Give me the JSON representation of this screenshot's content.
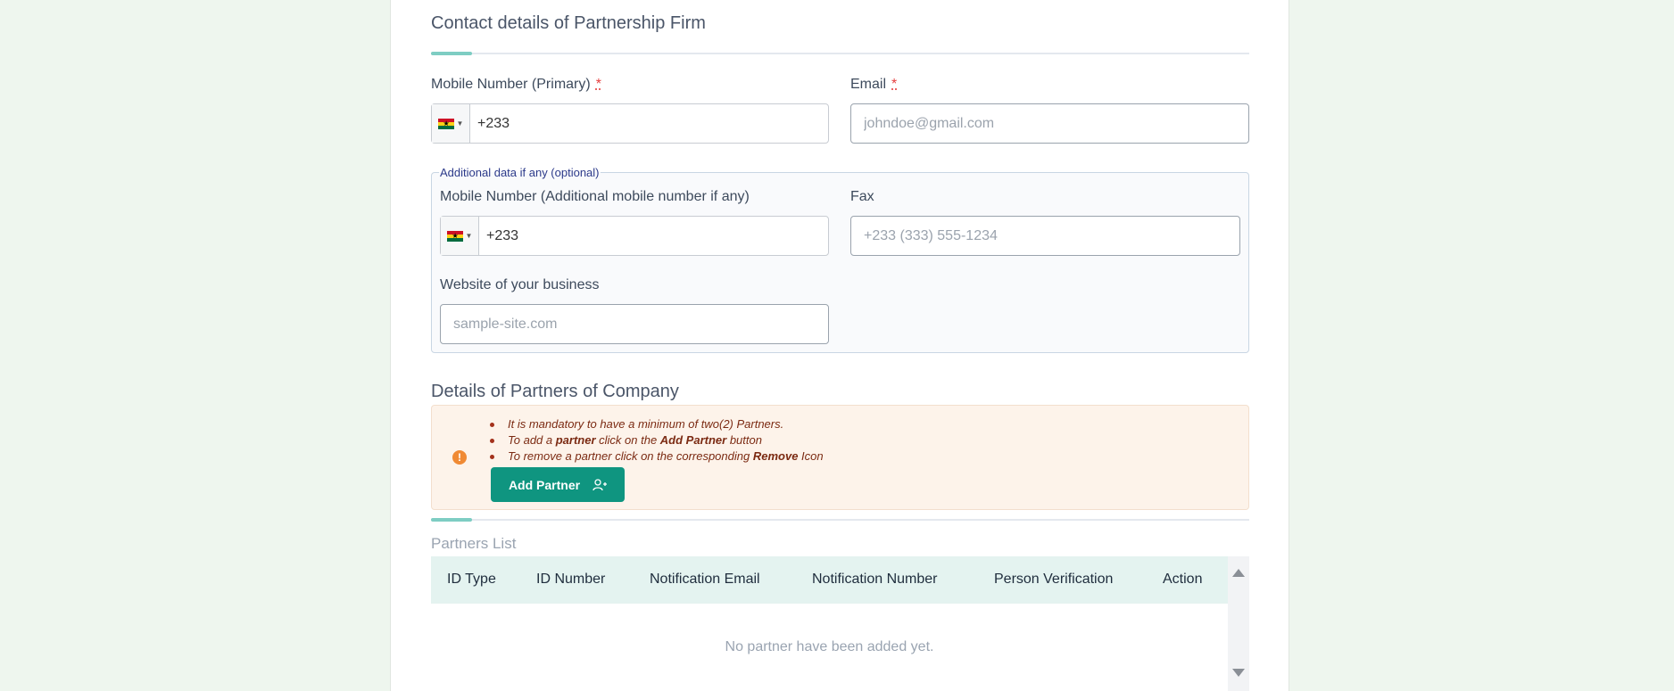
{
  "contact": {
    "title": "Contact details of Partnership Firm",
    "mobile_label": "Mobile Number (Primary)",
    "required_mark": "*",
    "mobile_value": "+233",
    "email_label": "Email",
    "email_placeholder": "johndoe@gmail.com"
  },
  "additional": {
    "legend": "Additional data if any (optional)",
    "mobile_label": "Mobile Number (Additional mobile number if any)",
    "mobile_value": "+233",
    "fax_label": "Fax",
    "fax_placeholder": "+233 (333) 555-1234",
    "website_label": "Website of your business",
    "website_placeholder": "sample-site.com"
  },
  "partners": {
    "title": "Details of Partners of Company",
    "notes": {
      "line1": "It is mandatory to have a minimum of two(2) Partners.",
      "line2_pre": "To add a ",
      "line2_bold1": "partner",
      "line2_mid": " click on the ",
      "line2_bold2": "Add Partner",
      "line2_post": " button",
      "line3_pre": "To remove a partner click on the corresponding ",
      "line3_bold": "Remove",
      "line3_post": " Icon"
    },
    "add_button": "Add Partner",
    "list_title": "Partners List",
    "columns": [
      "ID Type",
      "ID Number",
      "Notification Email",
      "Notification Number",
      "Person Verification",
      "Action"
    ],
    "empty_message": "No partner have been added yet."
  },
  "icons": {
    "country_flag": "ghana-flag-icon",
    "alert": "exclamation-circle-icon",
    "add_partner": "user-plus-icon"
  },
  "colors": {
    "accent": "#0f9580",
    "required": "#e53e3e",
    "alert_bg": "#fdf3ea",
    "alert_text": "#7b2a12"
  }
}
